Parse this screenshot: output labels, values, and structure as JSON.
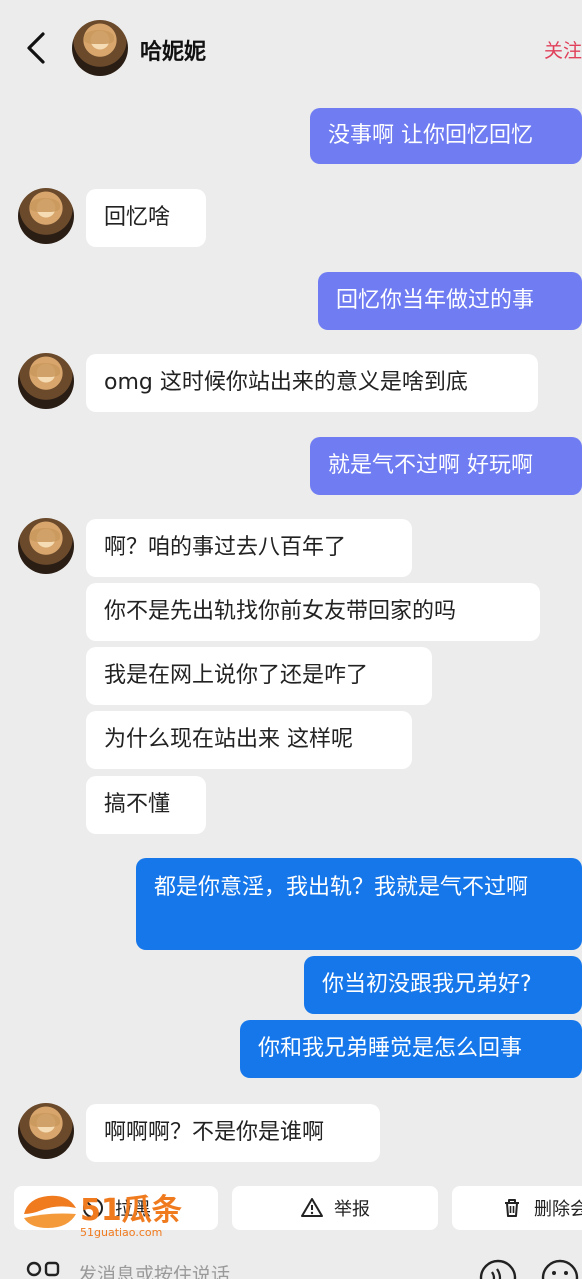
{
  "header": {
    "contact_name": "哈妮妮",
    "follow_label": "关注"
  },
  "messages": [
    {
      "side": "right",
      "text": "没事啊 让你回忆回忆"
    },
    {
      "side": "left",
      "text": "回忆啥"
    },
    {
      "side": "right",
      "text": "回忆你当年做过的事"
    },
    {
      "side": "left",
      "text": "omg 这时候你站出来的意义是啥到底"
    },
    {
      "side": "right",
      "text": "就是气不过啊 好玩啊"
    },
    {
      "side": "left",
      "text": "啊？咱的事过去八百年了"
    },
    {
      "side": "left",
      "text": "你不是先出轨找你前女友带回家的吗"
    },
    {
      "side": "left",
      "text": "我是在网上说你了还是咋了"
    },
    {
      "side": "left",
      "text": "为什么现在站出来 这样呢"
    },
    {
      "side": "left",
      "text": "搞不懂"
    },
    {
      "side": "right",
      "text": "都是你意淫，我出轨？我就是气不过啊"
    },
    {
      "side": "right",
      "text": "你当初没跟我兄弟好?"
    },
    {
      "side": "right",
      "text": "你和我兄弟睡觉是怎么回事"
    },
    {
      "side": "left",
      "text": "啊啊啊？不是你是谁啊"
    }
  ],
  "actions": {
    "block_label": "拉黑",
    "report_label": "举报",
    "delete_label": "删除会"
  },
  "input": {
    "placeholder": "发消息或按住说话"
  },
  "watermark": {
    "brand": "51瓜条",
    "domain": "51guatiao.com"
  },
  "colors": {
    "background": "#ececec",
    "sent_purple": "#6f7cf2",
    "sent_blue": "#1677ea",
    "received": "#ffffff",
    "follow_red": "#e0405a",
    "watermark_orange": "#f07a1e"
  }
}
